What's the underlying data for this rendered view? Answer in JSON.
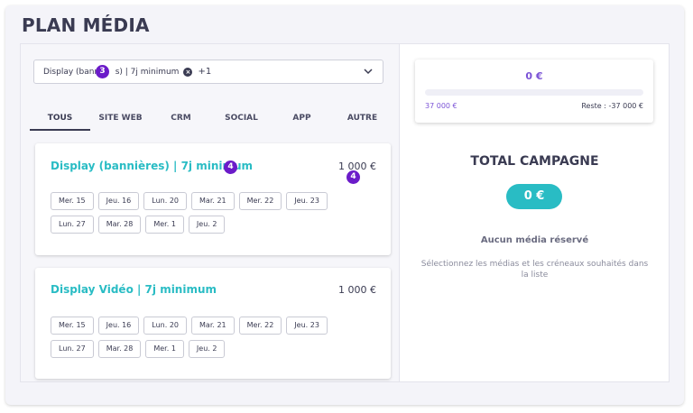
{
  "page": {
    "title": "PLAN MÉDIA"
  },
  "selector": {
    "selected_prefix": "Display (banni",
    "selected_suffix": "s) | 7j minimum",
    "more": "+1",
    "badge": "3"
  },
  "tabs": [
    {
      "label": "TOUS",
      "active": true
    },
    {
      "label": "SITE WEB",
      "active": false
    },
    {
      "label": "CRM",
      "active": false
    },
    {
      "label": "SOCIAL",
      "active": false
    },
    {
      "label": "APP",
      "active": false
    },
    {
      "label": "AUTRE",
      "active": false
    }
  ],
  "cards": [
    {
      "title": "Display (bannières) | 7j minimum",
      "price": "1 000 €",
      "title_badge": "4",
      "price_badge": "4",
      "slots": [
        "Mer. 15",
        "Jeu. 16",
        "Lun. 20",
        "Mar. 21",
        "Mer. 22",
        "Jeu. 23",
        "Lun. 27",
        "Mar. 28",
        "Mer. 1",
        "Jeu. 2"
      ]
    },
    {
      "title": "Display Vidéo | 7j minimum",
      "price": "1 000 €",
      "slots": [
        "Mer. 15",
        "Jeu. 16",
        "Lun. 20",
        "Mar. 21",
        "Mer. 22",
        "Jeu. 23",
        "Lun. 27",
        "Mar. 28",
        "Mer. 1",
        "Jeu. 2"
      ]
    }
  ],
  "budget": {
    "amount": "0 €",
    "progress": 0,
    "total": "37 000 €",
    "remaining": "Reste : -37 000 €"
  },
  "summary": {
    "title": "TOTAL CAMPAGNE",
    "total": "0 €",
    "empty_title": "Aucun média réservé",
    "empty_text": "Sélectionnez les médias et les créneaux souhaités dans la liste"
  },
  "colors": {
    "accent_teal": "#29bcc4",
    "accent_purple": "#7b53d6",
    "badge": "#6b1bc9"
  },
  "icons": {
    "remove": "x-circle-icon",
    "dropdown": "chevron-down-icon"
  }
}
